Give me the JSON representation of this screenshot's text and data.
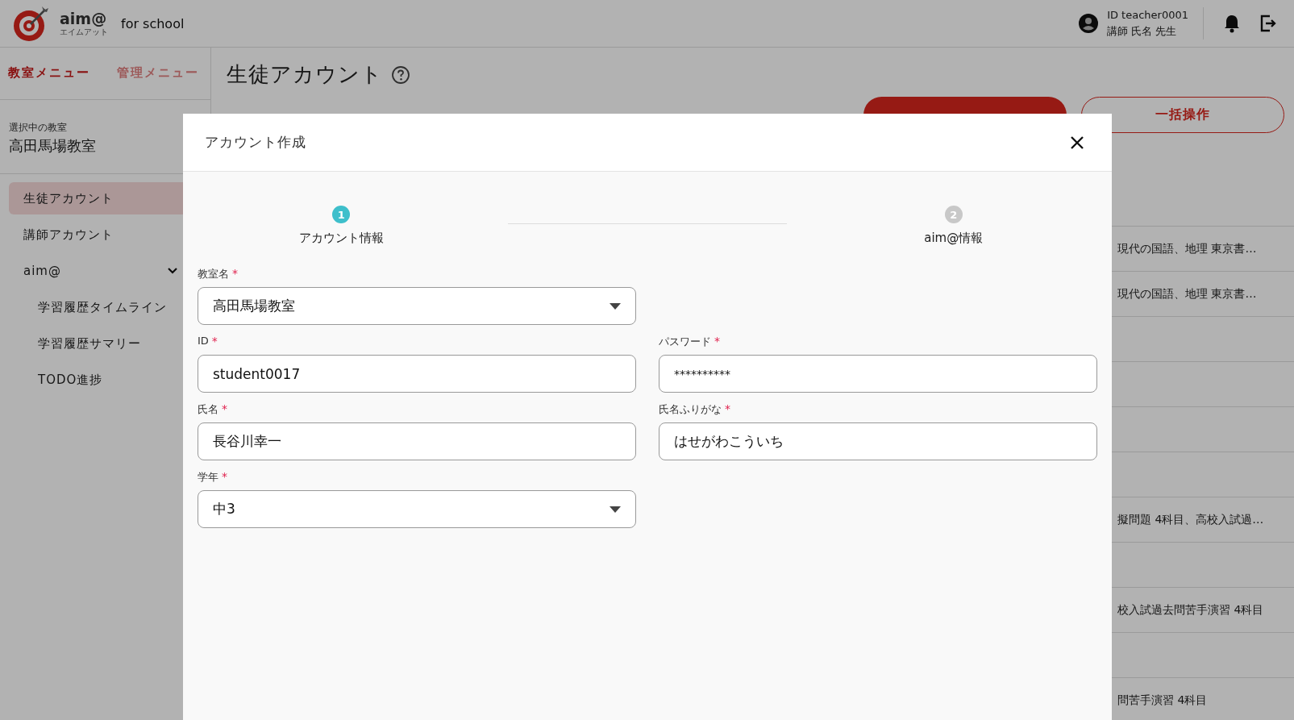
{
  "header": {
    "brand": "aim@",
    "brand_reading": "エイムアット",
    "subtitle": "for school",
    "user_id": "ID teacher0001",
    "user_name": "講師 氏名 先生"
  },
  "sidebar": {
    "menu_tabs": [
      {
        "label": "教室メニュー",
        "selected": true
      },
      {
        "label": "管理メニュー",
        "selected": false
      }
    ],
    "classroom_caption": "選択中の教室",
    "classroom_name": "高田馬場教室",
    "items": [
      {
        "label": "生徒アカウント",
        "selected": true
      },
      {
        "label": "講師アカウント",
        "selected": false
      },
      {
        "label": "aim@",
        "selected": false,
        "expanded": true,
        "children": [
          {
            "label": "学習履歴タイムライン",
            "selected": false
          },
          {
            "label": "学習履歴サマリー",
            "selected": false
          },
          {
            "label": "TODO進捗",
            "selected": false
          }
        ]
      }
    ]
  },
  "page": {
    "title": "生徒アカウント",
    "buttons": [
      {
        "kind": "primary"
      },
      {
        "label": "一括操作",
        "kind": "outline"
      }
    ],
    "table_rows": [
      {
        "cell": "現代の国語、地理 東京書…"
      },
      {
        "cell": "現代の国語、地理 東京書…"
      },
      {
        "cell": null
      },
      {
        "cell": null
      },
      {
        "cell": null
      },
      {
        "cell": null
      },
      {
        "cell": "擬問題 4科目、高校入試過…"
      },
      {
        "cell": null
      },
      {
        "cell": "校入試過去問苦手演習 4科目"
      },
      {
        "cell": null
      },
      {
        "cell": "問苦手演習 4科目"
      }
    ]
  },
  "dialog": {
    "title": "アカウント作成",
    "steps": [
      {
        "number": "1",
        "label": "アカウント情報",
        "selected": true
      },
      {
        "number": "2",
        "label": "aim@情報",
        "selected": false
      }
    ],
    "fields": [
      {
        "label": "教室名",
        "required_mark": "*",
        "kind": "select",
        "value": "高田馬場教室"
      },
      {
        "kind": "gap"
      },
      {
        "label": "ID",
        "required_mark": "*",
        "kind": "text",
        "value": "student0017"
      },
      {
        "label": "パスワード",
        "required_mark": "*",
        "kind": "password",
        "value": "**********"
      },
      {
        "label": "氏名",
        "required_mark": "*",
        "kind": "text",
        "value": "長谷川幸一"
      },
      {
        "label": "氏名ふりがな",
        "required_mark": "*",
        "kind": "text",
        "value": "はせがわこういち"
      },
      {
        "label": "学年",
        "required_mark": "*",
        "kind": "select",
        "value": "中3"
      }
    ]
  }
}
